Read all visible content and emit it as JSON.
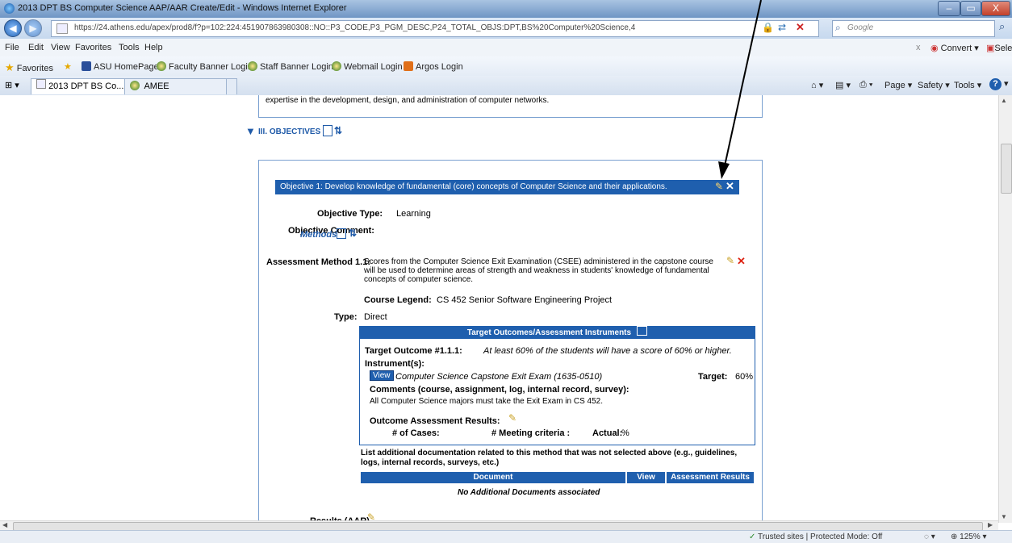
{
  "window": {
    "title": "2013 DPT BS Computer Science AAP/AAR Create/Edit - Windows Internet Explorer",
    "controls": [
      "–",
      "▭",
      "X"
    ]
  },
  "address": {
    "url": "https://24.athens.edu/apex/prod8/f?p=102:224:451907863980308::NO::P3_CODE,P3_PGM_DESC,P24_TOTAL_OBJS:DPT,BS%20Computer%20Science,4",
    "search_placeholder": "Google"
  },
  "menu": {
    "items": [
      "File",
      "Edit",
      "View",
      "Favorites",
      "Tools",
      "Help"
    ],
    "convert": "Convert",
    "select": "Sele"
  },
  "favorites": {
    "label": "Favorites",
    "links": [
      "ASU HomePage",
      "Faculty Banner Login",
      "Staff Banner Login",
      "Webmail Login",
      "Argos Login"
    ]
  },
  "tabs": {
    "items": [
      "2013 DPT BS Co...",
      "AMEE"
    ],
    "toolbar": [
      "Page",
      "Safety",
      "Tools"
    ]
  },
  "content": {
    "top_text": "expertise in the development, design, and administration of computer networks.",
    "section_title": "III. OBJECTIVES",
    "objective_header": "Objective 1: Develop knowledge of fundamental (core) concepts of Computer Science and their applications.",
    "objective_type_label": "Objective Type:",
    "objective_type_value": "Learning",
    "objective_comment_label": "Objective Comment:",
    "methods_label": "Methods",
    "method_label": "Assessment Method 1.1:",
    "method_text": "Scores from the Computer Science Exit Examination (CSEE) administered in the capstone course will be used to determine areas of strength and weakness in students' knowledge of fundamental concepts of computer science.",
    "course_legend_label": "Course Legend:",
    "course_legend_value": "CS 452 Senior Software Engineering Project",
    "type_label": "Type:",
    "type_value": "Direct",
    "target_header": "Target Outcomes/Assessment Instruments",
    "target_outcome_label": "Target Outcome #1.1.1:",
    "target_outcome_value": "At least 60% of the students will have a score of 60% or higher.",
    "instruments_label": "Instrument(s):",
    "view_label": "View",
    "instrument_name": "Computer Science Capstone Exit Exam (1635-0510)",
    "target_label": "Target:",
    "target_value": "60%",
    "comments_label": "Comments (course, assignment, log, internal record, survey):",
    "comments_value": "All Computer Science majors must take the Exit Exam in CS 452.",
    "results_label": "Outcome Assessment Results:",
    "cases_label": "# of Cases:",
    "meeting_label": "# Meeting criteria :",
    "actual_label": "Actual:",
    "actual_value": "%",
    "additional_doc_text": "List additional documentation related to this method that was not selected above (e.g., guidelines, logs, internal records, surveys, etc.)",
    "doc_col_document": "Document",
    "doc_col_view": "View",
    "doc_col_results": "Assessment Results",
    "no_docs": "No Additional Documents associated",
    "results_aar": "Results (AAR)"
  },
  "status": {
    "zone": "Trusted sites | Protected Mode: Off",
    "zoom": "125%"
  }
}
